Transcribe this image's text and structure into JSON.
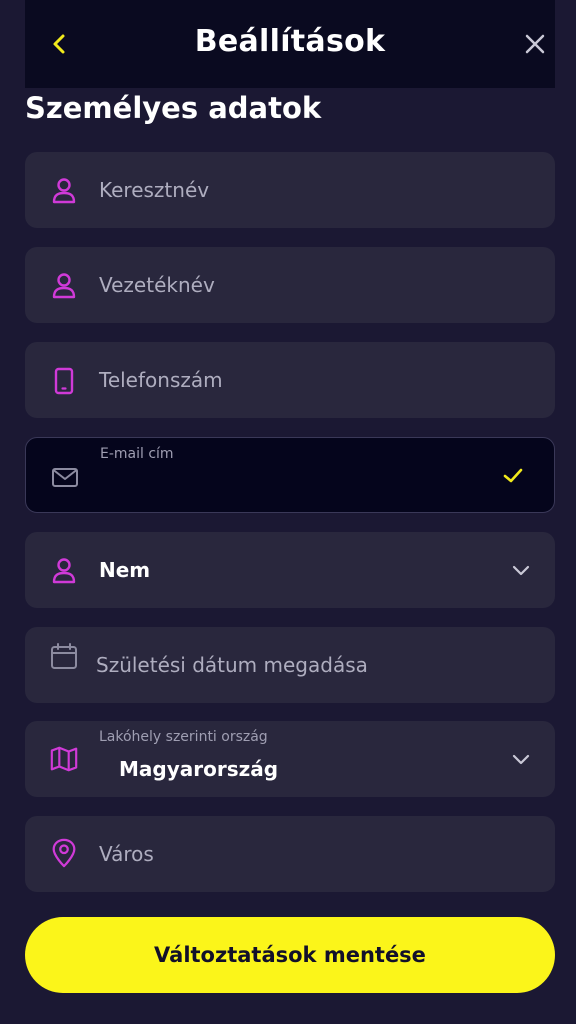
{
  "header": {
    "title": "Beállítások",
    "back_icon": "chevron-left-icon",
    "close_icon": "close-icon"
  },
  "section": {
    "title": "Személyes adatok"
  },
  "fields": {
    "first_name": {
      "placeholder": "Keresztnév",
      "icon": "user-icon"
    },
    "last_name": {
      "placeholder": "Vezetéknév",
      "icon": "user-icon"
    },
    "phone": {
      "placeholder": "Telefonszám",
      "icon": "phone-icon"
    },
    "email": {
      "label": "E-mail cím",
      "value": "",
      "icon": "mail-icon",
      "status_icon": "check-icon"
    },
    "gender": {
      "value": "Nem",
      "icon": "user-icon",
      "dropdown_icon": "chevron-down-icon"
    },
    "birthdate": {
      "placeholder": "Születési dátum megadása",
      "icon": "calendar-icon"
    },
    "country": {
      "label": "Lakóhely szerinti ország",
      "value": "Magyarország",
      "icon": "map-icon",
      "dropdown_icon": "chevron-down-icon"
    },
    "city": {
      "placeholder": "Város",
      "icon": "location-pin-icon"
    }
  },
  "save_button": {
    "label": "Változtatások mentése"
  },
  "colors": {
    "background": "#1b1833",
    "header_bg": "#0a0a20",
    "field_bg": "#29273d",
    "accent_magenta": "#d03ad8",
    "accent_yellow": "#fbf51a"
  }
}
